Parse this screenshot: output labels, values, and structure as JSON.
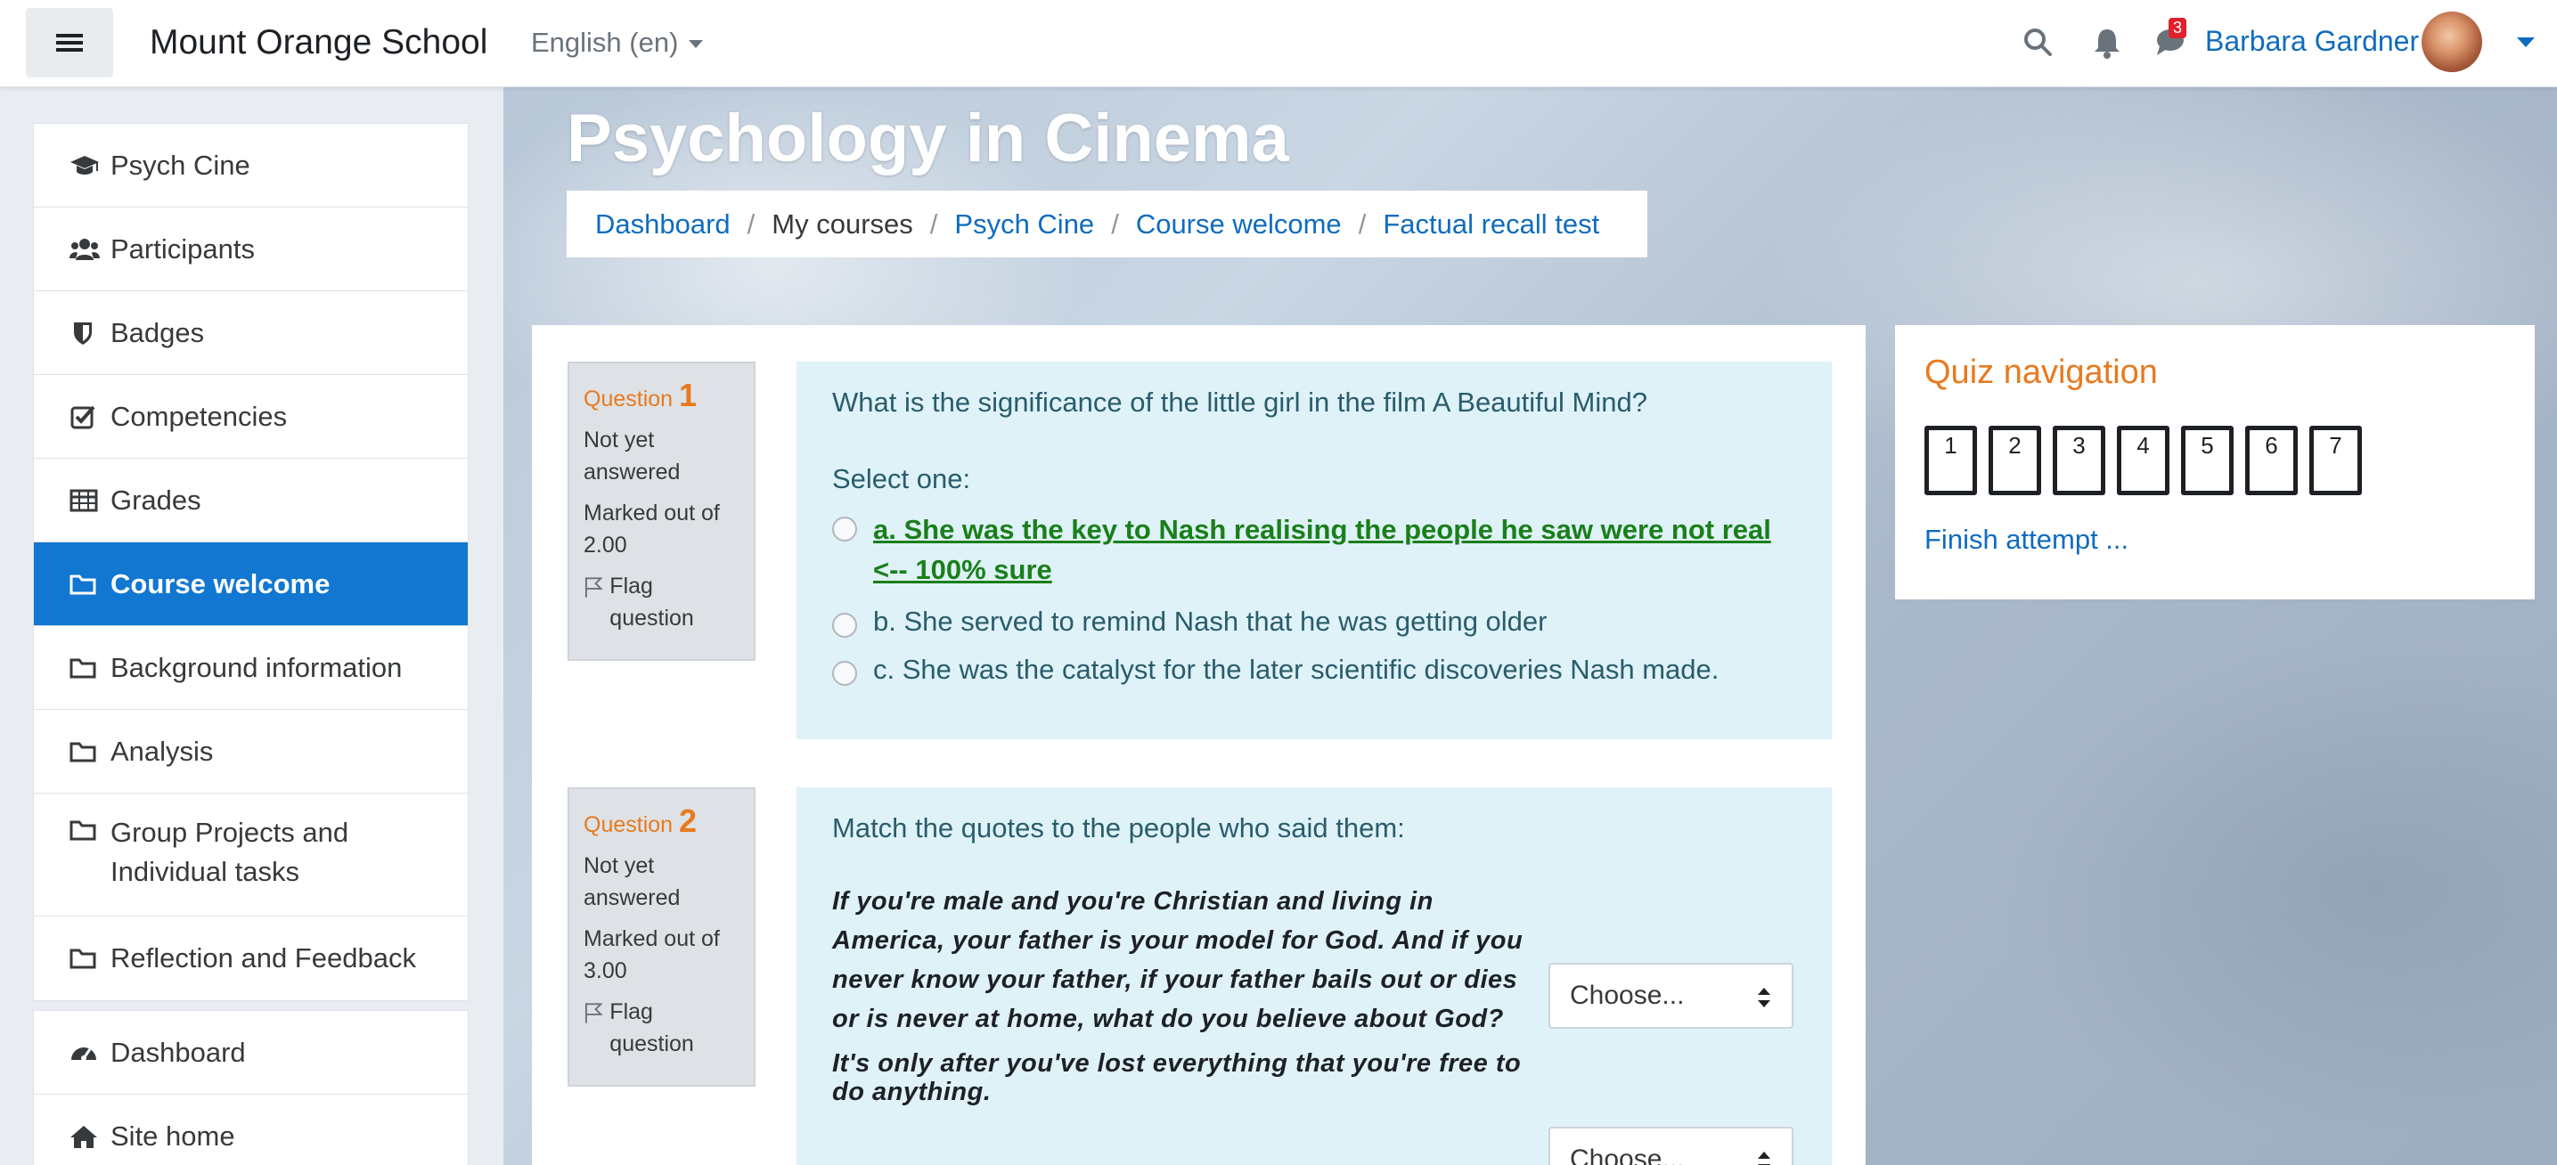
{
  "topbar": {
    "site_name": "Mount Orange School",
    "language": "English (en)",
    "message_count": "3",
    "user_name": "Barbara Gardner"
  },
  "sidebar": {
    "groups": [
      [
        {
          "label": "Psych Cine",
          "icon": "graduation-cap-icon"
        },
        {
          "label": "Participants",
          "icon": "users-icon"
        },
        {
          "label": "Badges",
          "icon": "shield-icon"
        },
        {
          "label": "Competencies",
          "icon": "check-square-icon"
        },
        {
          "label": "Grades",
          "icon": "table-icon"
        },
        {
          "label": "Course welcome",
          "icon": "folder-icon",
          "active": true
        },
        {
          "label": "Background information",
          "icon": "folder-icon"
        },
        {
          "label": "Analysis",
          "icon": "folder-icon"
        },
        {
          "label": "Group Projects and Individual tasks",
          "icon": "folder-icon"
        },
        {
          "label": "Reflection and Feedback",
          "icon": "folder-icon"
        }
      ],
      [
        {
          "label": "Dashboard",
          "icon": "dashboard-icon"
        },
        {
          "label": "Site home",
          "icon": "home-icon"
        }
      ]
    ]
  },
  "header": {
    "title": "Psychology in Cinema",
    "breadcrumb": [
      "Dashboard",
      "My courses",
      "Psych Cine",
      "Course welcome",
      "Factual recall test"
    ]
  },
  "questions": [
    {
      "label": "Question",
      "number": "1",
      "status": "Not yet answered",
      "marked": "Marked out of 2.00",
      "flag": "Flag question",
      "text": "What is the significance of the little girl in the film A Beautiful Mind?",
      "prompt": "Select one:",
      "options": [
        {
          "text": "a. She was the key to Nash realising the people he saw were not real <-- 100% sure",
          "highlighted": true
        },
        {
          "text": "b. She served to remind Nash that he was getting older"
        },
        {
          "text": "c. She was the catalyst for the later scientific discoveries Nash made."
        }
      ]
    },
    {
      "label": "Question",
      "number": "2",
      "status": "Not yet answered",
      "marked": "Marked out of 3.00",
      "flag": "Flag question",
      "text": "Match the quotes to the people who said them:",
      "quotes": [
        "If you're male and you're Christian and living in America, your father is your model for God. And if you never know your father, if your father bails out or dies or is never at home, what do you believe about God?",
        "It's only after you've lost everything that you're free to do anything."
      ],
      "select_placeholder": "Choose..."
    }
  ],
  "quiz_navigation": {
    "title": "Quiz navigation",
    "buttons": [
      "1",
      "2",
      "3",
      "4",
      "5",
      "6",
      "7"
    ],
    "finish": "Finish attempt ..."
  },
  "colors": {
    "accent": "#0f6cbf",
    "active_nav": "#1177d1",
    "question_orange": "#e87a1e",
    "question_bg": "#def2f8",
    "correct_green": "#1a7f1a"
  }
}
